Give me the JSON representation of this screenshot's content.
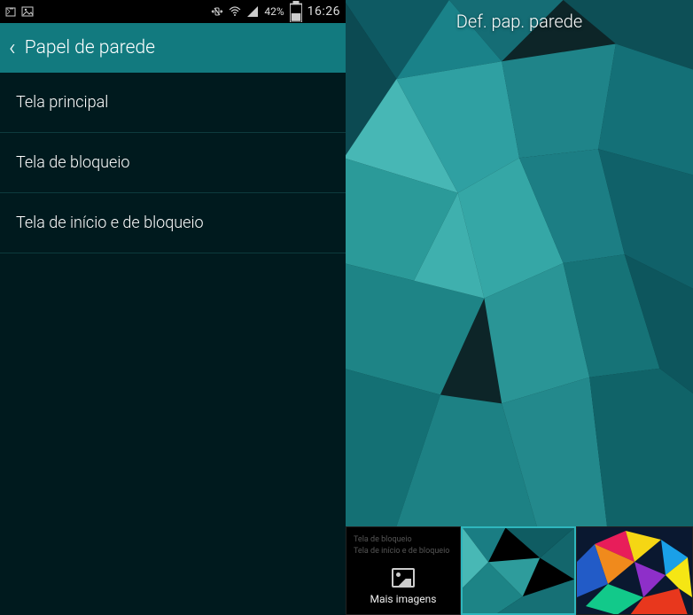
{
  "status": {
    "battery": "42%",
    "time": "16:26"
  },
  "left": {
    "header": "Papel de parede",
    "options": [
      "Tela principal",
      "Tela de bloqueio",
      "Tela de início e de bloqueio"
    ]
  },
  "right": {
    "title": "Def. pap. parede",
    "more_images": "Mais imagens",
    "mini1": "Tela de bloqueio",
    "mini2": "Tela de início e de bloqueio"
  }
}
